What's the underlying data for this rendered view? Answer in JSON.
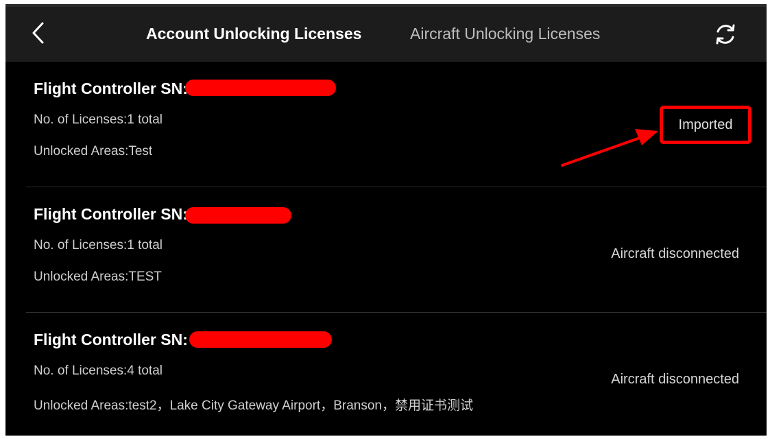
{
  "header": {
    "back_icon": "chevron-left-icon",
    "tabs": [
      {
        "label": "Account Unlocking Licenses",
        "active": true
      },
      {
        "label": "Aircraft Unlocking Licenses",
        "active": false
      }
    ],
    "refresh_icon": "refresh-icon"
  },
  "items": [
    {
      "sn_label": "Flight Controller SN:",
      "licenses": "No. of Licenses:1 total",
      "areas": "Unlocked Areas:Test",
      "status": "Imported"
    },
    {
      "sn_label": "Flight Controller SN:",
      "licenses": "No. of Licenses:1 total",
      "areas": "Unlocked Areas:TEST",
      "status": "Aircraft disconnected"
    },
    {
      "sn_label": "Flight Controller SN:",
      "licenses": "No. of Licenses:4 total",
      "areas": "Unlocked Areas:test2，Lake City Gateway Airport，Branson，禁用证书测试",
      "status": "Aircraft disconnected"
    }
  ],
  "colors": {
    "background": "#000000",
    "header": "#1c1c1c",
    "annotation": "#ff0000",
    "text_primary": "#ffffff",
    "text_secondary": "#d0d0d0"
  }
}
